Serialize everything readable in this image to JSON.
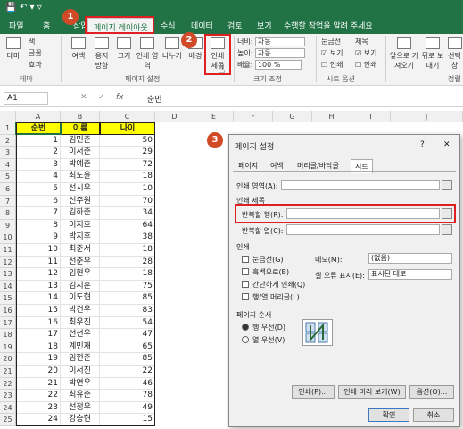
{
  "titlebar": {
    "quick_access": "↶  ▾  ▿"
  },
  "tabs": [
    {
      "label": "파일"
    },
    {
      "label": "홈"
    },
    {
      "label": "삽입"
    },
    {
      "label": "페이지 레이아웃"
    },
    {
      "label": "수식"
    },
    {
      "label": "데이터"
    },
    {
      "label": "검토"
    },
    {
      "label": "보기"
    },
    {
      "label": "수행할 작업을 알려 주세요"
    }
  ],
  "ribbon": {
    "theme": {
      "btn": "테마",
      "group": "테마",
      "colors": "색",
      "fonts": "글꼴",
      "effects": "효과"
    },
    "page_setup": {
      "margins": "여백",
      "orientation": "용지 방향",
      "size": "크기",
      "print_area": "인쇄 영역",
      "breaks": "나누기",
      "background": "배경",
      "print_titles": "인쇄 제목",
      "group": "페이지 설정"
    },
    "scale": {
      "width_label": "너비:",
      "width_value": "자동",
      "height_label": "높이:",
      "height_value": "자동",
      "scale_label": "배율:",
      "scale_value": "100 %",
      "group": "크기 조정"
    },
    "sheet_options": {
      "gridlines": "눈금선",
      "headings": "제목",
      "view": "보기",
      "print": "인쇄",
      "group": "시트 옵션"
    },
    "arrange": {
      "bring_forward": "앞으로 가져오기",
      "send_backward": "뒤로 보내기",
      "selection": "선택 창",
      "group": "정렬"
    }
  },
  "formula_bar": {
    "name_box": "A1",
    "fx": "fx",
    "content": "순번"
  },
  "columns": [
    "A",
    "B",
    "C",
    "D",
    "E",
    "F",
    "G",
    "H",
    "I",
    "J"
  ],
  "rows": [
    {
      "n": "1",
      "a": "순번",
      "b": "이름",
      "c": "나이"
    },
    {
      "n": "2",
      "a": "1",
      "b": "김민준",
      "c": "50"
    },
    {
      "n": "3",
      "a": "2",
      "b": "이서준",
      "c": "29"
    },
    {
      "n": "4",
      "a": "3",
      "b": "박예준",
      "c": "72"
    },
    {
      "n": "5",
      "a": "4",
      "b": "최도윤",
      "c": "18"
    },
    {
      "n": "6",
      "a": "5",
      "b": "선시우",
      "c": "10"
    },
    {
      "n": "7",
      "a": "6",
      "b": "신주원",
      "c": "70"
    },
    {
      "n": "8",
      "a": "7",
      "b": "김하준",
      "c": "34"
    },
    {
      "n": "9",
      "a": "8",
      "b": "이지호",
      "c": "64"
    },
    {
      "n": "10",
      "a": "9",
      "b": "박지후",
      "c": "38"
    },
    {
      "n": "11",
      "a": "10",
      "b": "최준서",
      "c": "18"
    },
    {
      "n": "12",
      "a": "11",
      "b": "선준우",
      "c": "28"
    },
    {
      "n": "13",
      "a": "12",
      "b": "임현우",
      "c": "18"
    },
    {
      "n": "14",
      "a": "13",
      "b": "김지훈",
      "c": "75"
    },
    {
      "n": "15",
      "a": "14",
      "b": "이도현",
      "c": "85"
    },
    {
      "n": "16",
      "a": "15",
      "b": "박건우",
      "c": "83"
    },
    {
      "n": "17",
      "a": "16",
      "b": "최우진",
      "c": "54"
    },
    {
      "n": "18",
      "a": "17",
      "b": "선선우",
      "c": "47"
    },
    {
      "n": "19",
      "a": "18",
      "b": "계민재",
      "c": "65"
    },
    {
      "n": "20",
      "a": "19",
      "b": "임현준",
      "c": "85"
    },
    {
      "n": "21",
      "a": "20",
      "b": "이서진",
      "c": "22"
    },
    {
      "n": "22",
      "a": "21",
      "b": "박연우",
      "c": "46"
    },
    {
      "n": "23",
      "a": "22",
      "b": "최유준",
      "c": "78"
    },
    {
      "n": "24",
      "a": "23",
      "b": "선정우",
      "c": "49"
    },
    {
      "n": "25",
      "a": "24",
      "b": "강승현",
      "c": "15"
    }
  ],
  "callouts": [
    "1",
    "2",
    "3"
  ],
  "dialog": {
    "title": "페이지 설정",
    "help": "?",
    "close": "✕",
    "tabs": [
      "페이지",
      "여백",
      "머리글/바닥글",
      "시트"
    ],
    "print_area_label": "인쇄 영역(A):",
    "print_titles_label": "인쇄 제목",
    "rows_repeat_label": "반복할 행(R):",
    "cols_repeat_label": "반복할 열(C):",
    "print_label": "인쇄",
    "gridlines": "눈금선(G)",
    "bw": "흑백으로(B)",
    "draft": "간단하게 인쇄(Q)",
    "rowcol": "행/열 머리글(L)",
    "comments_label": "메모(M):",
    "comments_value": "(없음)",
    "errors_label": "셀 오류 표시(E):",
    "errors_value": "표시된 대로",
    "order_label": "페이지 순서",
    "down_then_over": "행 우선(D)",
    "over_then_down": "열 우선(V)",
    "print_btn": "인쇄(P)...",
    "preview_btn": "인쇄 미리 보기(W)",
    "options_btn": "옵션(O)...",
    "ok_btn": "확인",
    "cancel_btn": "취소"
  },
  "colors": {
    "excel_green": "#217346",
    "highlight": "#ffff00",
    "callout": "#d04a28",
    "red_box": "#e02020"
  }
}
